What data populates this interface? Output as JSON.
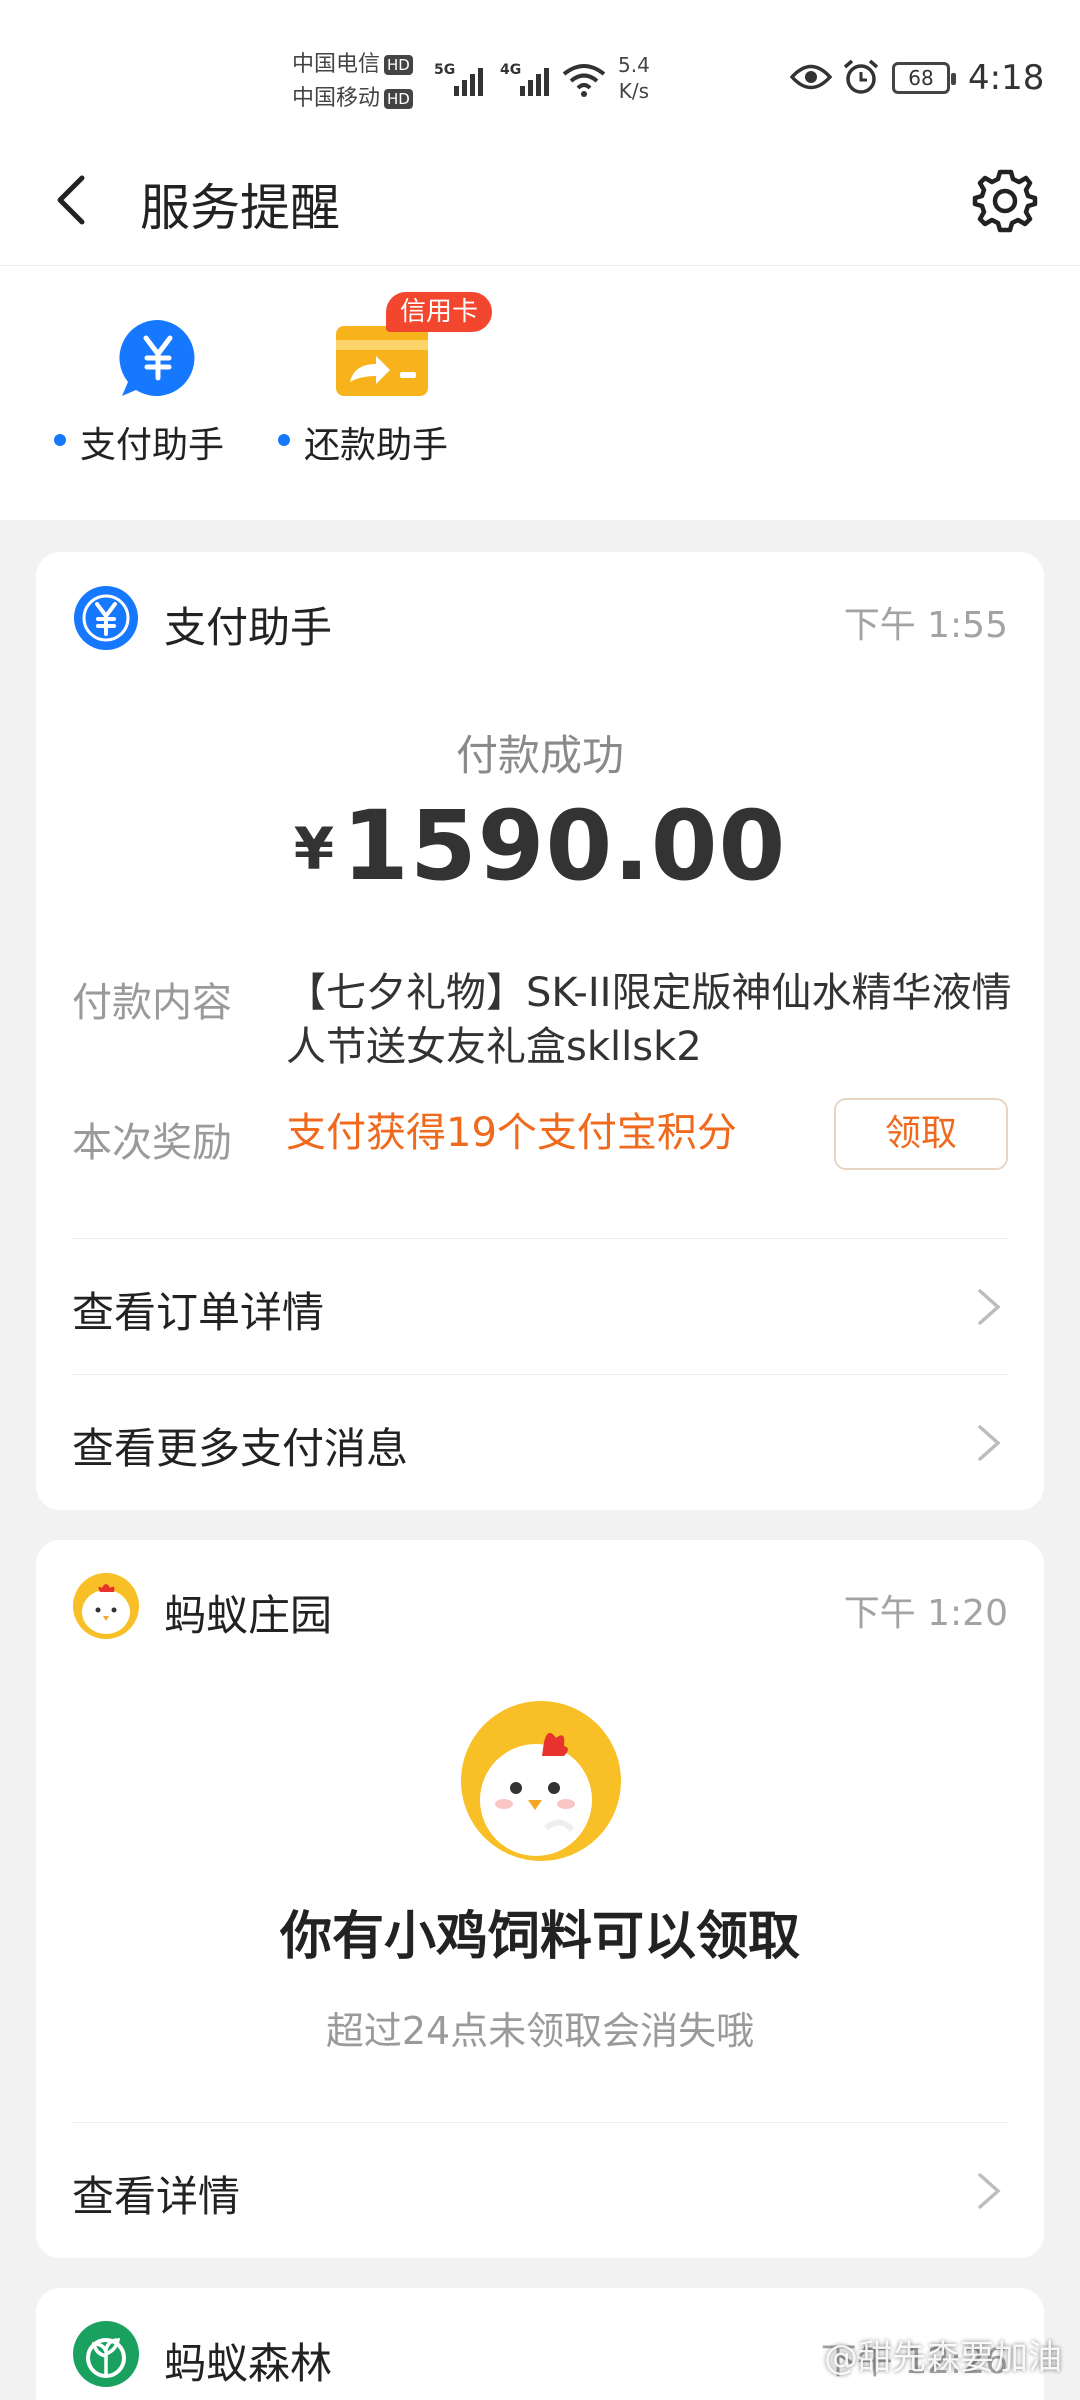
{
  "status_bar": {
    "carrier1": "中国电信",
    "carrier2": "中国移动",
    "hd": "HD",
    "sig1_tag": "5G",
    "sig2_tag": "4G",
    "speed_value": "5.4",
    "speed_unit": "K/s",
    "battery": "68",
    "time": "4:18",
    "icons": [
      "wifi-icon",
      "eye-icon",
      "alarm-icon",
      "battery-icon"
    ]
  },
  "header": {
    "title": "服务提醒",
    "back_icon": "chevron-left-icon",
    "settings_icon": "gear-icon"
  },
  "quick_entries": [
    {
      "label": "支付助手",
      "icon": "yuan-chat-icon"
    },
    {
      "label": "还款助手",
      "icon": "card-repay-icon",
      "badge": "信用卡"
    }
  ],
  "cards": {
    "pay_assistant": {
      "name": "支付助手",
      "time": "下午 1:55",
      "status": "付款成功",
      "currency": "¥",
      "amount": "1590.00",
      "content_label": "付款内容",
      "content_value": "【七夕礼物】SK-II限定版神仙水精华液情人节送女友礼盒skllsk2",
      "reward_label": "本次奖励",
      "reward_value": "支付获得19个支付宝积分",
      "claim_button": "领取",
      "links": [
        "查看订单详情",
        "查看更多支付消息"
      ]
    },
    "ant_farm": {
      "name": "蚂蚁庄园",
      "time": "下午 1:20",
      "headline": "你有小鸡饲料可以领取",
      "subline": "超过24点未领取会消失哦",
      "link": "查看详情"
    },
    "ant_forest": {
      "name": "蚂蚁森林",
      "time": "下午 12:26"
    }
  },
  "watermark": "@甜先森要加油",
  "colors": {
    "accent_blue": "#1677ff",
    "reward_orange": "#f06a1d",
    "badge_red": "#f2462e",
    "card_yellow": "#f8c026"
  }
}
